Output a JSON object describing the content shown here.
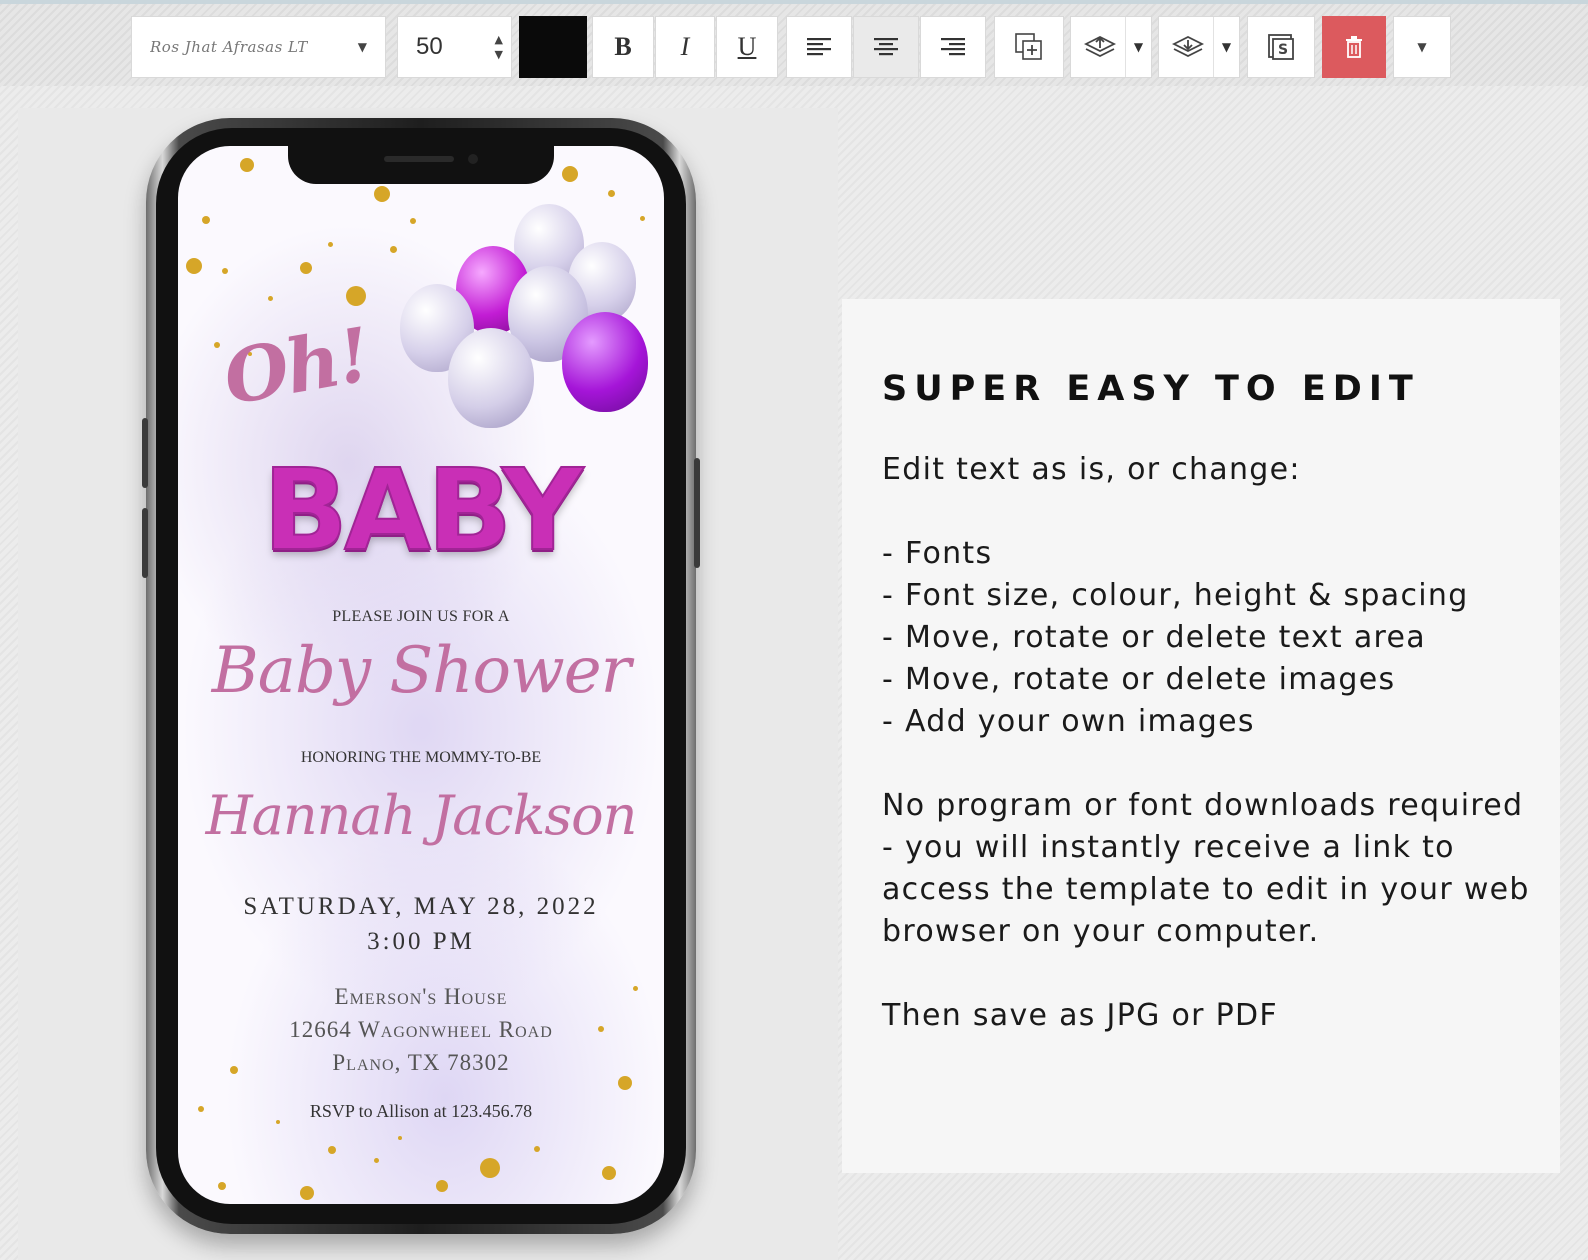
{
  "toolbar": {
    "font_name": "Ros Jhat Afrasas LT",
    "font_size": "50",
    "text_color": "#0a0a0a",
    "bold_label": "B",
    "italic_label": "I",
    "underline_label": "U",
    "icons": {
      "align_left": "align-left-icon",
      "align_center": "align-center-icon",
      "align_right": "align-right-icon",
      "duplicate": "duplicate-icon",
      "bring_forward": "bring-forward-icon",
      "send_backward": "send-backward-icon",
      "save": "save-icon",
      "delete": "trash-icon",
      "more": "chevron-down-icon"
    },
    "delete_color": "#dc5a5e"
  },
  "invitation": {
    "oh": "Oh!",
    "baby": "BABY",
    "join": "PLEASE JOIN US FOR A",
    "event": "Baby Shower",
    "honoring": "HONORING THE MOMMY-TO-BE",
    "name": "Hannah Jackson",
    "date": "SATURDAY, MAY 28, 2022",
    "time": "3:00 PM",
    "address_line1": "Emerson's House",
    "address_line2": "12664 Wagonwheel Road",
    "address_line3": "Plano, TX 78302",
    "rsvp": "RSVP to Allison  at 123.456.78",
    "accent_color": "#c26fa1",
    "balloon_color": "#c92fb6"
  },
  "info": {
    "title": "SUPER EASY TO EDIT",
    "intro": "Edit text as is, or change:",
    "items": [
      "- Fonts",
      "- Font size, colour, height & spacing",
      "- Move, rotate or delete text area",
      "- Move, rotate or delete images",
      "- Add your own images"
    ],
    "paragraph": "No program or font downloads required - you will instantly receive a link to access the template to edit in your web browser on your computer.",
    "save_note": "Then save as JPG or PDF"
  }
}
